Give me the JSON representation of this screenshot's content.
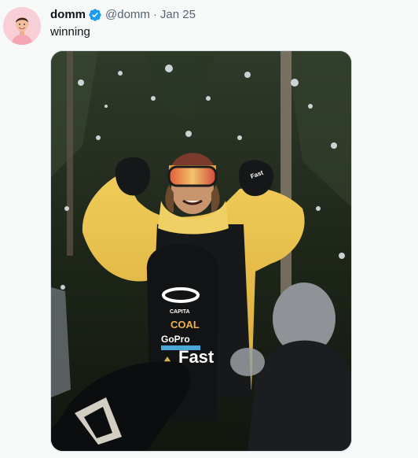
{
  "tweet": {
    "display_name": "domm",
    "handle": "@domm",
    "separator": "·",
    "date": "Jan 25",
    "text": "winning",
    "verified_icon": "verified-badge-icon",
    "avatar_icon": "profile-avatar"
  },
  "media": {
    "board_logos": {
      "brand1": "CAPITA",
      "brand2": "COAL",
      "brand3": "GoPro",
      "brand4": "Fast"
    },
    "glove_text": "Fast"
  },
  "colors": {
    "accent": "#1d9bf0",
    "text_primary": "#0f1419",
    "text_secondary": "#536471",
    "background": "#f7f9f9",
    "jacket": "#e9c24a"
  }
}
